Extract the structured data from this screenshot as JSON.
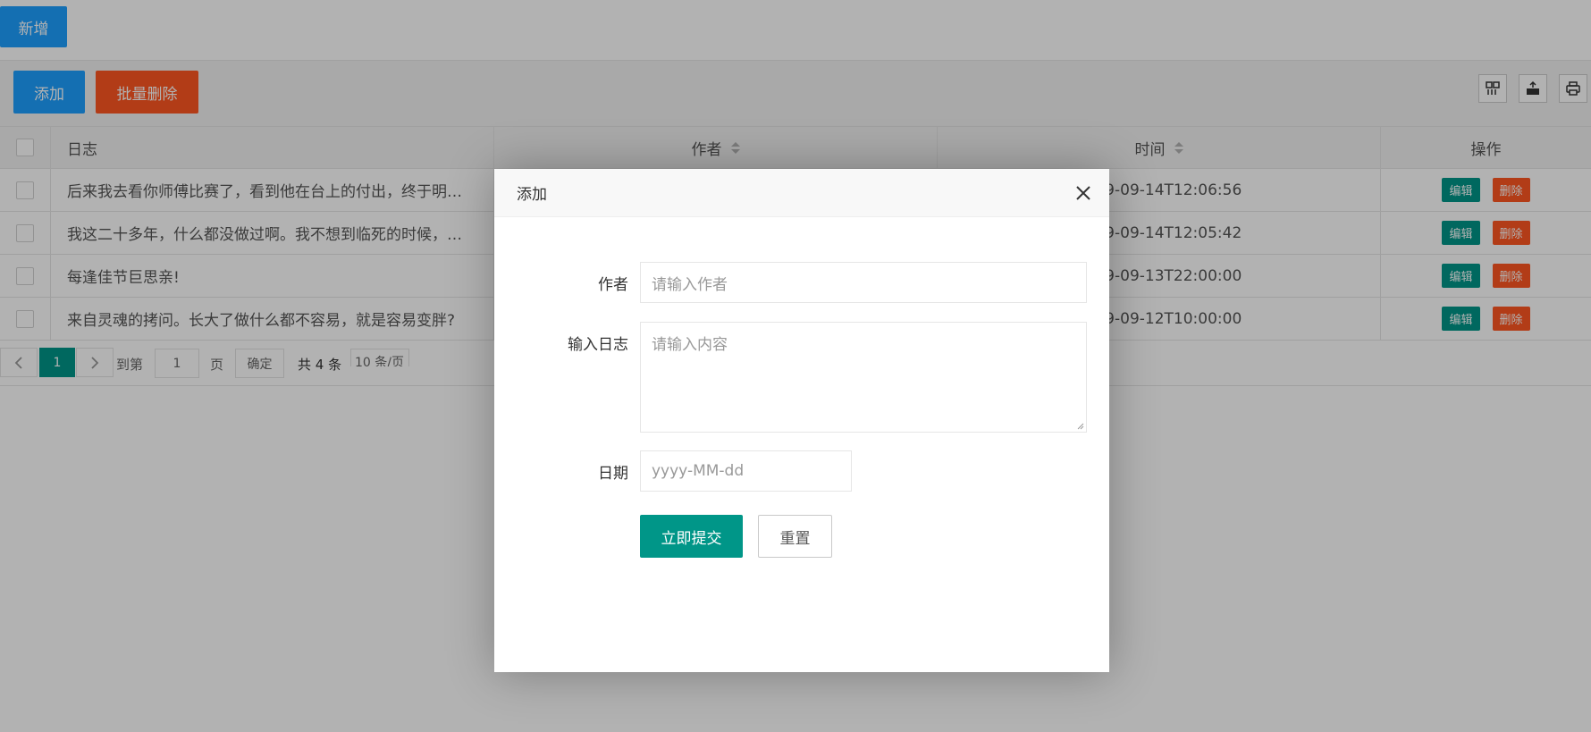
{
  "topbar": {
    "new_label": "新增"
  },
  "toolbar": {
    "add_label": "添加",
    "batch_delete_label": "批量删除",
    "icons": [
      "columns-icon",
      "export-icon",
      "print-icon"
    ]
  },
  "table": {
    "headers": {
      "log": "日志",
      "author": "作者",
      "time": "时间",
      "ops": "操作"
    },
    "rows": [
      {
        "log": "后来我去看你师傅比赛了，看到他在台上的付出，终于明…",
        "author": "",
        "time": "2019-09-14T12:06:56",
        "time_visible": "9-09-14T12:06:56"
      },
      {
        "log": "我这二十多年，什么都没做过啊。我不想到临死的时候，…",
        "author": "",
        "time": "2019-09-14T12:05:42",
        "time_visible": "9-09-14T12:05:42"
      },
      {
        "log": "每逢佳节巨思亲!",
        "author": "",
        "time": "2019-09-13T22:00:00",
        "time_visible": "9-09-13T22:00:00"
      },
      {
        "log": "来自灵魂的拷问。长大了做什么都不容易，就是容易变胖?",
        "author": "",
        "time": "2019-09-12T10:00:00",
        "time_visible": "9-09-12T10:00:00"
      }
    ],
    "edit_label": "编辑",
    "delete_label": "删除"
  },
  "pager": {
    "current_page": "1",
    "goto_prefix": "到第",
    "goto_value": "1",
    "goto_suffix": "页",
    "confirm_label": "确定",
    "total_text": "共 4 条",
    "page_size_text": "10 条/页"
  },
  "modal": {
    "title": "添加",
    "author_label": "作者",
    "author_placeholder": "请输入作者",
    "log_label": "输入日志",
    "log_placeholder": "请输入内容",
    "date_label": "日期",
    "date_placeholder": "yyyy-MM-dd",
    "submit_label": "立即提交",
    "reset_label": "重置"
  },
  "colors": {
    "primary_blue": "#1e9fff",
    "danger_orange": "#ff5722",
    "teal": "#009688"
  }
}
